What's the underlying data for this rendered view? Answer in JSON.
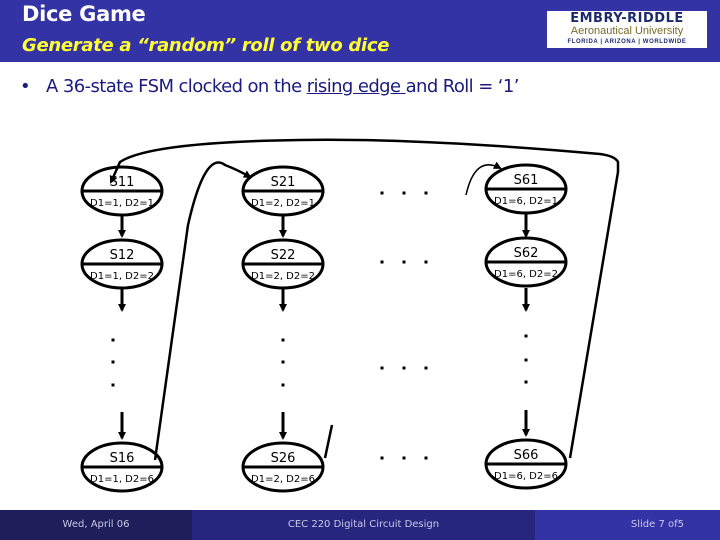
{
  "header": {
    "title": "Dice Game",
    "subtitle": "Generate a “random” roll of two dice",
    "background_color": "#3333a6",
    "subtitle_color": "#ffff33"
  },
  "logo": {
    "line1": "EMBRY-RIDDLE",
    "line2": "Aeronautical University",
    "line3": "FLORIDA | ARIZONA | WORLDWIDE"
  },
  "bullet": {
    "before": "A 36-state FSM clocked on the ",
    "underlined": "rising edge ",
    "after": "and Roll = ‘1’"
  },
  "diagram": {
    "states": [
      {
        "id": "s11",
        "name": "S11",
        "output": "D1=1, D2=1"
      },
      {
        "id": "s12",
        "name": "S12",
        "output": "D1=1, D2=2"
      },
      {
        "id": "s16",
        "name": "S16",
        "output": "D1=1, D2=6"
      },
      {
        "id": "s21",
        "name": "S21",
        "output": "D1=2, D2=1"
      },
      {
        "id": "s22",
        "name": "S22",
        "output": "D1=2, D2=2"
      },
      {
        "id": "s26",
        "name": "S26",
        "output": "D1=2, D2=6"
      },
      {
        "id": "s61",
        "name": "S61",
        "output": "D1=6, D2=1"
      },
      {
        "id": "s62",
        "name": "S62",
        "output": "D1=6, D2=2"
      },
      {
        "id": "s66",
        "name": "S66",
        "output": "D1=6, D2=6"
      }
    ],
    "ellipsis_h": ". . .",
    "ellipsis_v": "."
  },
  "footer": {
    "date": "Wed, April 06",
    "course": "CEC 220 Digital Circuit Design",
    "slide": "Slide 7 of5"
  }
}
